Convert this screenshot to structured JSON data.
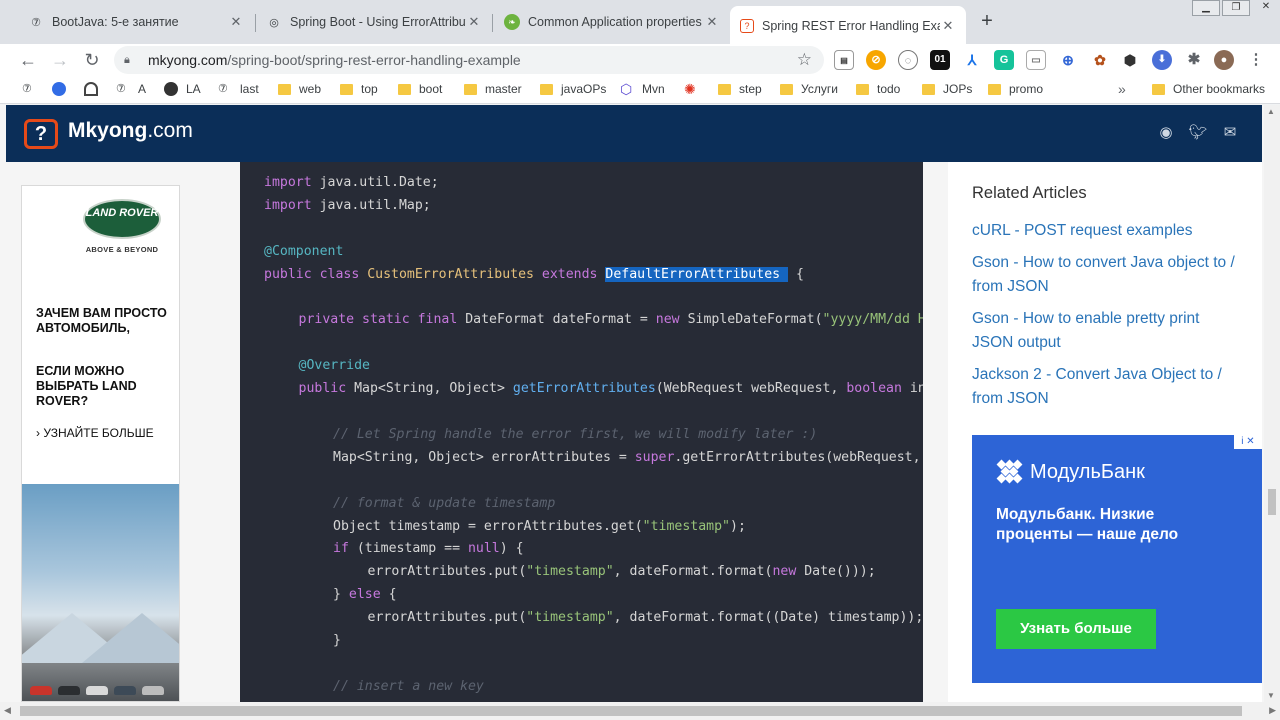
{
  "tabs": [
    {
      "title": "BootJava: 5-е занятие",
      "favicon": "bootjava-icon"
    },
    {
      "title": "Spring Boot - Using ErrorAttribut",
      "favicon": "spring-icon"
    },
    {
      "title": "Common Application properties",
      "favicon": "spring-leaf-icon"
    },
    {
      "title": "Spring REST Error Handling Exam",
      "favicon": "mkyong-icon",
      "active": true
    }
  ],
  "window_controls": {
    "minimize": "▁",
    "restore": "❐",
    "close": "✕"
  },
  "address": {
    "domain": "mkyong.com",
    "path": "/spring-boot/spring-rest-error-handling-example"
  },
  "bookmarks": [
    {
      "label": "",
      "icon": "bootjava-icon"
    },
    {
      "label": "",
      "icon": "kubernetes-icon"
    },
    {
      "label": "",
      "icon": "speedometer-icon"
    },
    {
      "label": "A",
      "icon": "bootjava-icon"
    },
    {
      "label": "LA",
      "icon": "globe-icon"
    },
    {
      "label": "last",
      "icon": "bootjava-icon"
    },
    {
      "label": "web",
      "icon": "folder-icon"
    },
    {
      "label": "top",
      "icon": "folder-icon"
    },
    {
      "label": "boot",
      "icon": "folder-icon"
    },
    {
      "label": "master",
      "icon": "folder-icon"
    },
    {
      "label": "javaOPs",
      "icon": "folder-icon"
    },
    {
      "label": "Mvn",
      "icon": "hexagon-icon"
    },
    {
      "label": "",
      "icon": "ferris-icon"
    },
    {
      "label": "step",
      "icon": "folder-icon"
    },
    {
      "label": "Услуги",
      "icon": "folder-icon"
    },
    {
      "label": "todo",
      "icon": "folder-icon"
    },
    {
      "label": "JOPs",
      "icon": "folder-icon"
    },
    {
      "label": "promo",
      "icon": "folder-icon"
    }
  ],
  "bookmarks_more": "»",
  "other_bookmarks": "Other bookmarks",
  "site": {
    "logo_mark": "?",
    "name": "Mkyong",
    "tld": ".com"
  },
  "left_ad": {
    "brand": "LAND ROVER",
    "tagline": "ABOVE & BEYOND",
    "text1": "ЗАЧЕМ ВАМ ПРОСТО АВТОМОБИЛЬ,",
    "text2": "ЕСЛИ МОЖНО ВЫБРАТЬ LAND ROVER?",
    "cta": "› УЗНАЙТЕ БОЛЬШЕ"
  },
  "code_lines": [
    {
      "indent": 0,
      "tokens": [
        {
          "c": "kw",
          "t": "import"
        },
        {
          "c": "",
          "t": " java.util.Date;"
        }
      ]
    },
    {
      "indent": 0,
      "tokens": [
        {
          "c": "kw",
          "t": "import"
        },
        {
          "c": "",
          "t": " java.util.Map;"
        }
      ]
    },
    {
      "indent": 0,
      "tokens": []
    },
    {
      "indent": 0,
      "tokens": [
        {
          "c": "an",
          "t": "@Component"
        }
      ]
    },
    {
      "indent": 0,
      "tokens": [
        {
          "c": "kw",
          "t": "public class "
        },
        {
          "c": "ty",
          "t": "CustomErrorAttributes"
        },
        {
          "c": "kw",
          "t": " extends "
        },
        {
          "c": "hl",
          "t": "DefaultErrorAttributes "
        },
        {
          "c": "",
          "t": " {"
        }
      ]
    },
    {
      "indent": 0,
      "tokens": []
    },
    {
      "indent": 1,
      "tokens": [
        {
          "c": "kw",
          "t": "private static final "
        },
        {
          "c": "",
          "t": "DateFormat dateFormat = "
        },
        {
          "c": "kw",
          "t": "new "
        },
        {
          "c": "",
          "t": "SimpleDateFormat("
        },
        {
          "c": "st",
          "t": "\"yyyy/MM/dd HH:mm:ss\""
        },
        {
          "c": "",
          "t": ");"
        }
      ]
    },
    {
      "indent": 0,
      "tokens": []
    },
    {
      "indent": 1,
      "tokens": [
        {
          "c": "an",
          "t": "@Override"
        }
      ]
    },
    {
      "indent": 1,
      "tokens": [
        {
          "c": "kw",
          "t": "public "
        },
        {
          "c": "",
          "t": "Map<String, Object> "
        },
        {
          "c": "fn",
          "t": "getErrorAttributes"
        },
        {
          "c": "",
          "t": "(WebRequest webRequest, "
        },
        {
          "c": "kw",
          "t": "boolean"
        },
        {
          "c": "",
          "t": " includeStackTrace) {"
        }
      ]
    },
    {
      "indent": 0,
      "tokens": []
    },
    {
      "indent": 2,
      "tokens": [
        {
          "c": "cm",
          "t": "// Let Spring handle the error first, we will modify later :)"
        }
      ]
    },
    {
      "indent": 2,
      "tokens": [
        {
          "c": "",
          "t": "Map<String, Object> errorAttributes = "
        },
        {
          "c": "kw",
          "t": "super"
        },
        {
          "c": "",
          "t": ".getErrorAttributes(webRequest, includeStackTrace);"
        }
      ]
    },
    {
      "indent": 0,
      "tokens": []
    },
    {
      "indent": 2,
      "tokens": [
        {
          "c": "cm",
          "t": "// format & update timestamp"
        }
      ]
    },
    {
      "indent": 2,
      "tokens": [
        {
          "c": "",
          "t": "Object timestamp = errorAttributes.get("
        },
        {
          "c": "st",
          "t": "\"timestamp\""
        },
        {
          "c": "",
          "t": ");"
        }
      ]
    },
    {
      "indent": 2,
      "tokens": [
        {
          "c": "kw",
          "t": "if "
        },
        {
          "c": "",
          "t": "(timestamp == "
        },
        {
          "c": "kw",
          "t": "null"
        },
        {
          "c": "",
          "t": ") {"
        }
      ]
    },
    {
      "indent": 3,
      "tokens": [
        {
          "c": "",
          "t": "errorAttributes.put("
        },
        {
          "c": "st",
          "t": "\"timestamp\""
        },
        {
          "c": "",
          "t": ", dateFormat.format("
        },
        {
          "c": "kw",
          "t": "new "
        },
        {
          "c": "",
          "t": "Date()));"
        }
      ]
    },
    {
      "indent": 2,
      "tokens": [
        {
          "c": "",
          "t": "} "
        },
        {
          "c": "kw",
          "t": "else "
        },
        {
          "c": "",
          "t": "{"
        }
      ]
    },
    {
      "indent": 3,
      "tokens": [
        {
          "c": "",
          "t": "errorAttributes.put("
        },
        {
          "c": "st",
          "t": "\"timestamp\""
        },
        {
          "c": "",
          "t": ", dateFormat.format((Date) timestamp));"
        }
      ]
    },
    {
      "indent": 2,
      "tokens": [
        {
          "c": "",
          "t": "}"
        }
      ]
    },
    {
      "indent": 0,
      "tokens": []
    },
    {
      "indent": 2,
      "tokens": [
        {
          "c": "cm",
          "t": "// insert a new key"
        }
      ]
    }
  ],
  "sidebar": {
    "title": "Related Articles",
    "links": [
      "cURL - POST request examples",
      "Gson - How to convert Java object to / from JSON",
      "Gson - How to enable pretty print JSON output",
      "Jackson 2 - Convert Java Object to / from JSON"
    ]
  },
  "bank_ad": {
    "brand": "МодульБанк",
    "headline": "Модульбанк. Низкие проценты — наше дело",
    "cta": "Узнать больше",
    "adchoice": "i ✕"
  }
}
